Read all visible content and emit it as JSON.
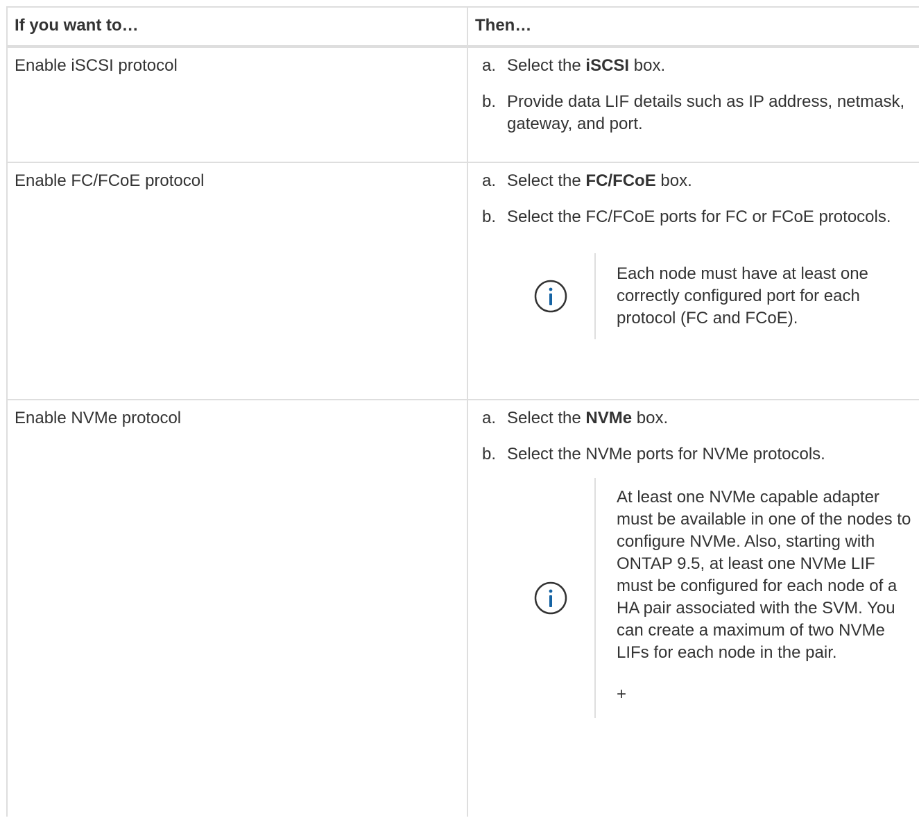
{
  "table": {
    "header": {
      "col1": "If you want to…",
      "col2": "Then…"
    },
    "rows": [
      {
        "want": "Enable iSCSI protocol",
        "steps": [
          {
            "marker": "a.",
            "pre": "Select the ",
            "bold": "iSCSI",
            "post": " box."
          },
          {
            "marker": "b.",
            "text": "Provide data LIF details such as IP address, netmask, gateway, and port."
          }
        ]
      },
      {
        "want": "Enable FC/FCoE protocol",
        "steps": [
          {
            "marker": "a.",
            "pre": "Select the ",
            "bold": "FC/FCoE",
            "post": " box."
          },
          {
            "marker": "b.",
            "text": "Select the FC/FCoE ports for FC or FCoE protocols."
          }
        ],
        "note": {
          "icon": "info-icon",
          "text": "Each node must have at least one correctly configured port for each protocol (FC and FCoE)."
        }
      },
      {
        "want": "Enable NVMe protocol",
        "steps": [
          {
            "marker": "a.",
            "pre": "Select the ",
            "bold": "NVMe",
            "post": " box."
          },
          {
            "marker": "b.",
            "text": "Select the NVMe ports for NVMe protocols."
          }
        ],
        "note": {
          "icon": "info-icon",
          "text": "At least one NVMe capable adapter must be available in one of the nodes to configure NVMe. Also, starting with ONTAP 9.5, at least one NVMe LIF must be configured for each node of a HA pair associated with the SVM. You can create a maximum of two NVMe LIFs for each node in the pair.",
          "extra": "+"
        }
      }
    ]
  },
  "colors": {
    "text": "#333333",
    "border": "#dedede",
    "icon": "#1563a3"
  }
}
